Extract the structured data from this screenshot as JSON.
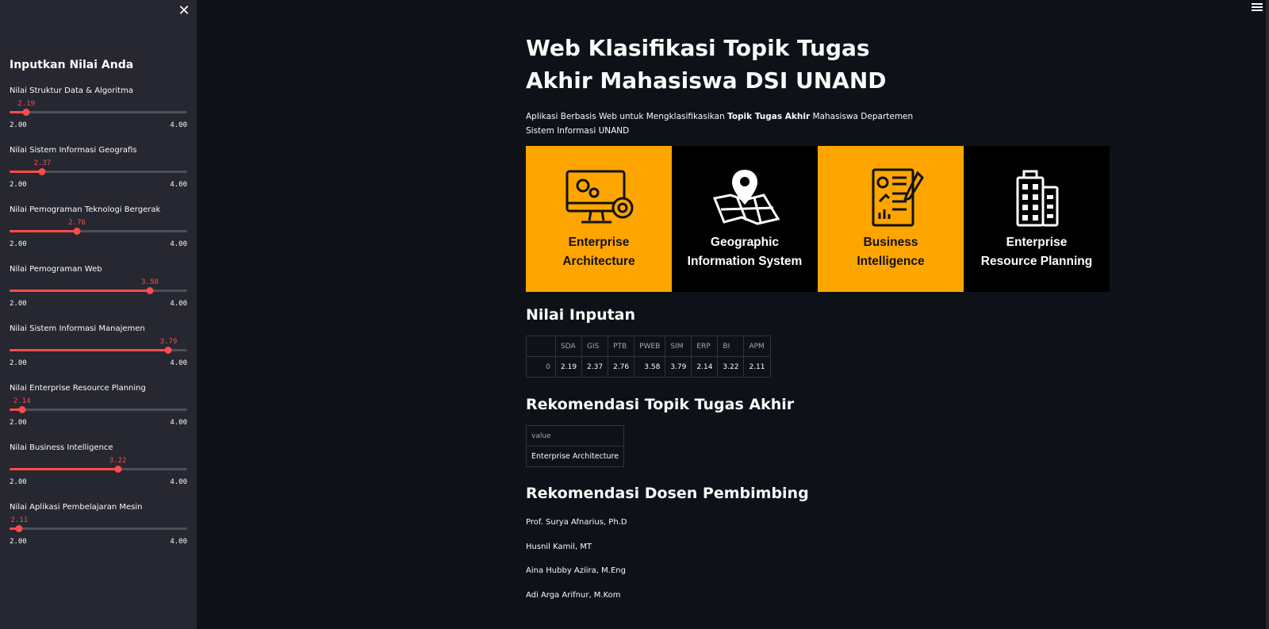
{
  "sidebar": {
    "close_icon": "close-icon",
    "title": "Inputkan Nilai Anda",
    "min_label": "2.00",
    "max_label": "4.00",
    "sliders": [
      {
        "label": "Nilai Struktur Data & Algoritma",
        "value": "2.19",
        "num": 2.19
      },
      {
        "label": "Nilai Sistem Informasi Geografis",
        "value": "2.37",
        "num": 2.37
      },
      {
        "label": "Nilai Pemograman Teknologi Bergerak",
        "value": "2.76",
        "num": 2.76
      },
      {
        "label": "Nilai Pemograman Web",
        "value": "3.58",
        "num": 3.58
      },
      {
        "label": "Nilai Sistem Informasi Manajemen",
        "value": "3.79",
        "num": 3.79
      },
      {
        "label": "Nilai Enterprise Resource Planning",
        "value": "2.14",
        "num": 2.14
      },
      {
        "label": "Nilai Business Intelligence",
        "value": "3.22",
        "num": 3.22
      },
      {
        "label": "Nilai Aplikasi Pembelajaran Mesin",
        "value": "2.11",
        "num": 2.11
      }
    ]
  },
  "main": {
    "title": "Web Klasifikasi Topik Tugas Akhir Mahasiswa DSI UNAND",
    "subtitle_pre": "Aplikasi Berbasis Web untuk Mengklasifikasikan ",
    "subtitle_bold": "Topik Tugas Akhir",
    "subtitle_post": " Mahasiswa Departemen Sistem Informasi UNAND",
    "banner": [
      {
        "line1": "Enterprise",
        "line2": "Architecture",
        "icon": "monitor-gears-icon",
        "color": "#ffa500"
      },
      {
        "line1": "Geographic",
        "line2": "Information System",
        "icon": "map-pin-icon",
        "color": "#000000"
      },
      {
        "line1": "Business",
        "line2": "Intelligence",
        "icon": "report-chart-icon",
        "color": "#ffa500"
      },
      {
        "line1": "Enterprise",
        "line2": "Resource Planning",
        "icon": "building-icon",
        "color": "#000000"
      }
    ],
    "input_heading": "Nilai Inputan",
    "input_table": {
      "headers": [
        "",
        "SDA",
        "GIS",
        "PTB",
        "PWEB",
        "SIM",
        "ERP",
        "BI",
        "APM"
      ],
      "row": [
        "0",
        "2.19",
        "2.37",
        "2.76",
        "3.58",
        "3.79",
        "2.14",
        "3.22",
        "2.11"
      ]
    },
    "topic_heading": "Rekomendasi Topik Tugas Akhir",
    "topic_table": {
      "header": "value",
      "value": "Enterprise Architecture"
    },
    "lecturer_heading": "Rekomendasi Dosen Pembimbing",
    "lecturers": [
      "Prof. Surya Afnarius, Ph.D",
      "Husnil Kamil, MT",
      "Aina Hubby Aziira, M.Eng",
      "Adi Arga Arifnur, M.Kom"
    ]
  },
  "colors": {
    "background": "#0e1117",
    "sidebar": "#262730",
    "accent": "#ff4b4b",
    "banner_orange": "#ffa500"
  }
}
